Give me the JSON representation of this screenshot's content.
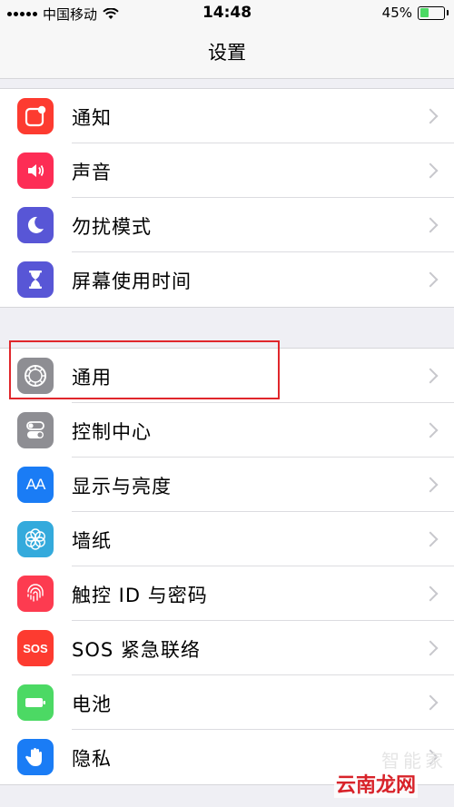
{
  "status_bar": {
    "carrier": "中国移动",
    "time": "14:48",
    "battery_percent": "45%",
    "battery_level": 0.45
  },
  "nav": {
    "title": "设置"
  },
  "groups": [
    {
      "items": [
        {
          "label": "通知",
          "icon": "notifications-icon",
          "color": "#fd3b30"
        },
        {
          "label": "声音",
          "icon": "speaker-icon",
          "color": "#fd2d55"
        },
        {
          "label": "勿扰模式",
          "icon": "moon-icon",
          "color": "#5856d6"
        },
        {
          "label": "屏幕使用时间",
          "icon": "hourglass-icon",
          "color": "#5856d6"
        }
      ]
    },
    {
      "items": [
        {
          "label": "通用",
          "icon": "gear-icon",
          "color": "#8e8e93"
        },
        {
          "label": "控制中心",
          "icon": "toggles-icon",
          "color": "#8e8e93"
        },
        {
          "label": "显示与亮度",
          "icon": "text-size-icon",
          "color": "#1a7cf5"
        },
        {
          "label": "墙纸",
          "icon": "flower-icon",
          "color": "#34aadc"
        },
        {
          "label": "触控 ID 与密码",
          "icon": "fingerprint-icon",
          "color": "#fd3b50"
        },
        {
          "label": "SOS 紧急联络",
          "icon": "sos-icon",
          "color": "#fd3b30"
        },
        {
          "label": "电池",
          "icon": "battery-icon",
          "color": "#4cd964"
        },
        {
          "label": "隐私",
          "icon": "hand-icon",
          "color": "#1a7cf5"
        }
      ]
    }
  ],
  "icon_texts": {
    "display": "AA",
    "sos": "SOS"
  },
  "watermark": {
    "text": "云南龙网",
    "faint": "智能家"
  }
}
